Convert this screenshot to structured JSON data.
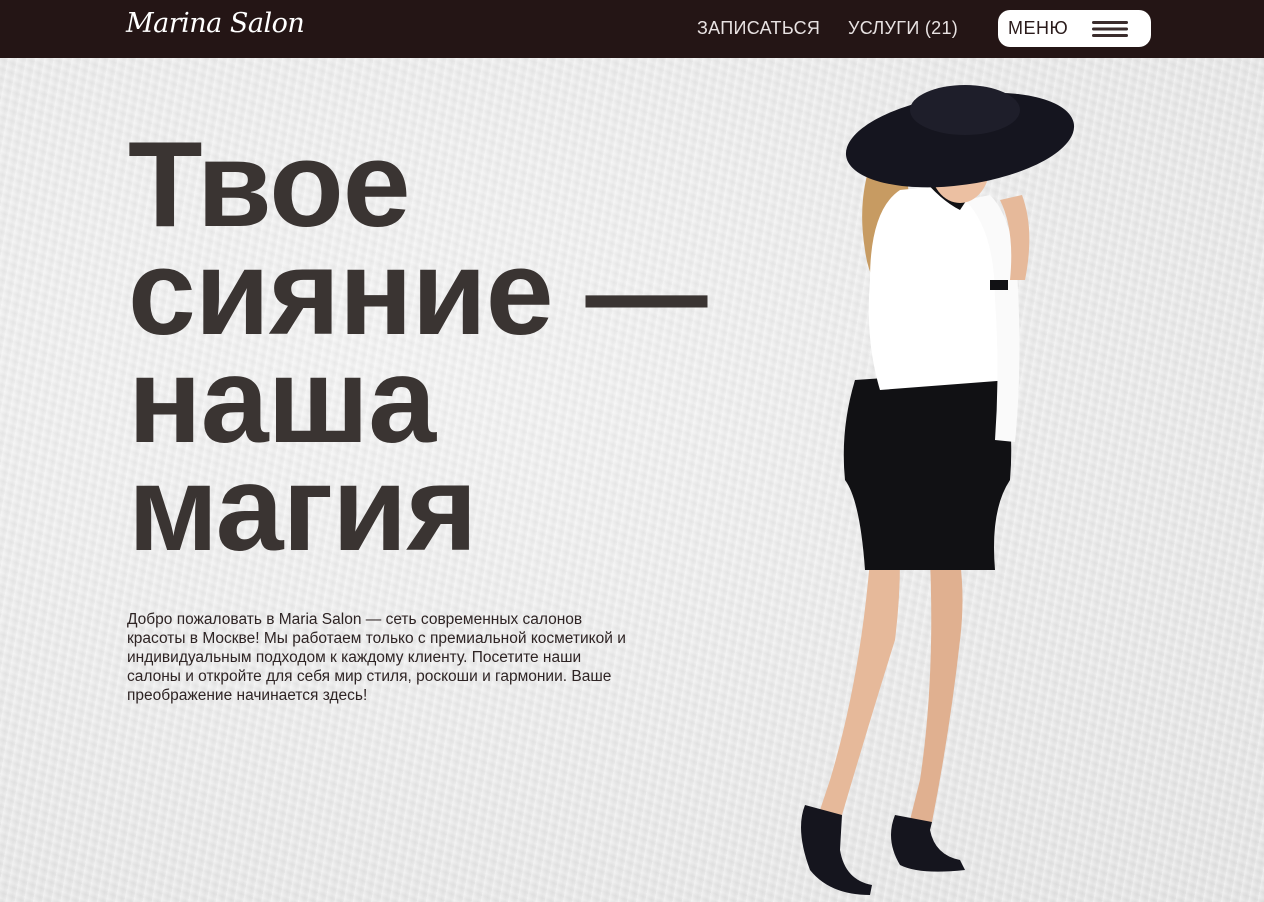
{
  "header": {
    "logo": "Marina Salon",
    "nav": {
      "book_label": "ЗАПИСАТЬСЯ",
      "services_label": "УСЛУГИ (21)"
    },
    "menu_label": "МЕНЮ",
    "background_color": "#241515"
  },
  "hero": {
    "headline_lines": [
      "Твое",
      "сияние —",
      "наша",
      "магия"
    ],
    "intro": "Добро пожаловать в Maria Salon — сеть современных салонов красоты в Москве! Мы работаем только с премиальной косметикой и индивидуальным подходом к каждому клиенту. Посетите наши салоны и откройте для себя мир стиля, роскоши и гармонии. Ваше преображение начинается здесь!",
    "headline_color": "#3a3432"
  },
  "icons": {
    "menu": "hamburger-icon"
  }
}
